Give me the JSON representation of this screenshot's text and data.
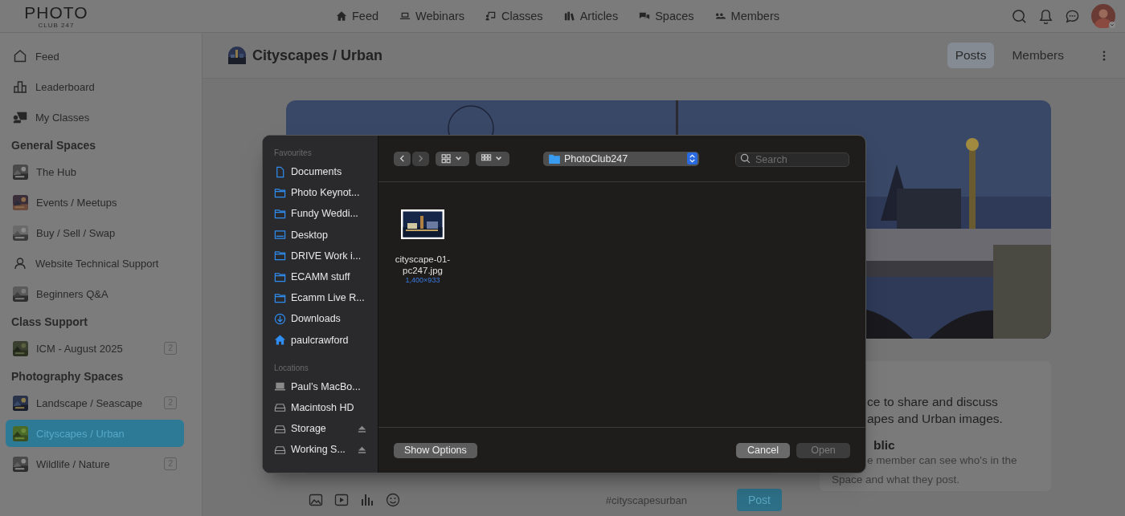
{
  "logo": {
    "title": "PHOTO",
    "subtitle": "CLUB 247"
  },
  "top_nav": [
    {
      "label": "Feed"
    },
    {
      "label": "Webinars"
    },
    {
      "label": "Classes"
    },
    {
      "label": "Articles"
    },
    {
      "label": "Spaces"
    },
    {
      "label": "Members"
    }
  ],
  "sidebar": {
    "items": [
      {
        "label": "Feed",
        "selected": false
      },
      {
        "label": "Leaderboard",
        "selected": false
      },
      {
        "label": "My Classes",
        "selected": false
      }
    ],
    "sections": [
      {
        "title": "General Spaces",
        "items": [
          {
            "label": "The Hub",
            "kind": "picture",
            "selected": false
          },
          {
            "label": "Events / Meetups",
            "kind": "picture",
            "selected": false
          },
          {
            "label": "Buy / Sell / Swap",
            "kind": "picture",
            "selected": false
          },
          {
            "label": "Website Technical Support",
            "kind": "person",
            "selected": false
          },
          {
            "label": "Beginners Q&A",
            "kind": "picture",
            "selected": false
          }
        ]
      },
      {
        "title": "Class Support",
        "items": [
          {
            "label": "ICM - August 2025",
            "kind": "picture",
            "badge": "2",
            "selected": false
          }
        ]
      },
      {
        "title": "Photography Spaces",
        "items": [
          {
            "label": "Landscape / Seascape",
            "kind": "picture",
            "badge": "2",
            "selected": false
          },
          {
            "label": "Cityscapes / Urban",
            "kind": "picture",
            "selected": true
          },
          {
            "label": "Wildlife / Nature",
            "kind": "picture",
            "badge": "2",
            "selected": false
          }
        ]
      }
    ]
  },
  "space": {
    "title": "Cityscapes / Urban",
    "tabs": [
      {
        "label": "Posts",
        "selected": true
      },
      {
        "label": "Members",
        "selected": false
      }
    ]
  },
  "about": {
    "lines": [
      "ce to share and discuss",
      "apes and Urban images."
    ],
    "privacy_title": "blic",
    "privacy_lines": [
      "e member can see who's in the",
      "Space and what they post."
    ]
  },
  "composer": {
    "hashtag": "#cityscapesurban",
    "post_button": "Post"
  },
  "file_dialog": {
    "favourites_title": "Favourites",
    "favourites": [
      {
        "label": "Documents"
      },
      {
        "label": "Photo Keynot..."
      },
      {
        "label": "Fundy Weddi..."
      },
      {
        "label": "Desktop"
      },
      {
        "label": "DRIVE Work i..."
      },
      {
        "label": "ECAMM stuff"
      },
      {
        "label": "Ecamm Live R..."
      },
      {
        "label": "Downloads"
      },
      {
        "label": "paulcrawford"
      }
    ],
    "locations_title": "Locations",
    "locations": [
      {
        "label": "Paul’s MacBo...",
        "eject": false
      },
      {
        "label": "Macintosh HD",
        "eject": false
      },
      {
        "label": "Storage",
        "eject": true
      },
      {
        "label": "Working S...",
        "eject": true
      }
    ],
    "folder": "PhotoClub247",
    "search": {
      "placeholder": "Search"
    },
    "files": [
      {
        "name": "cityscape-01-pc247.jpg",
        "dimensions": "1,400×933"
      }
    ],
    "show_options": "Show Options",
    "cancel": "Cancel",
    "open": {
      "label": "Open",
      "disabled": true
    }
  }
}
